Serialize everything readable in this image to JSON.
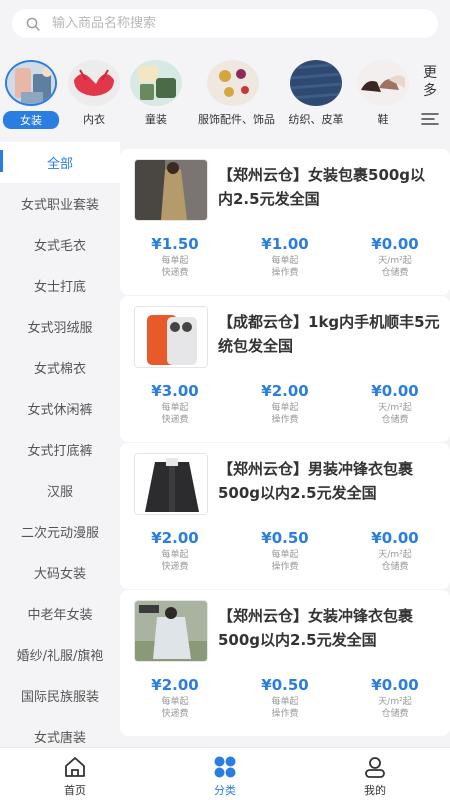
{
  "search": {
    "placeholder": "输入商品名称搜索"
  },
  "categories": [
    {
      "label": "女装",
      "active": true
    },
    {
      "label": "内衣"
    },
    {
      "label": "童装"
    },
    {
      "label": "服饰配件、饰品"
    },
    {
      "label": "纺织、皮革"
    },
    {
      "label": "鞋"
    }
  ],
  "more_label": "更多",
  "sidebar": {
    "items": [
      "全部",
      "女式职业套装",
      "女式毛衣",
      "女士打底",
      "女式羽绒服",
      "女式棉衣",
      "女式休闲裤",
      "女式打底裤",
      "汉服",
      "二次元动漫服",
      "大码女装",
      "中老年女装",
      "婚纱/礼服/旗袍",
      "国际民族服装",
      "女式唐装"
    ]
  },
  "fee_labels": {
    "express_unit": "每单起",
    "express_label": "快递费",
    "operation_unit": "每单起",
    "operation_label": "操作费",
    "storage_unit": "天/m²起",
    "storage_label": "仓储费"
  },
  "products": [
    {
      "title": "【郑州云仓】女装包裹500g以内2.5元发全国",
      "express": "¥1.50",
      "operation": "¥1.00",
      "storage": "¥0.00"
    },
    {
      "title": "【成都云仓】1kg内手机顺丰5元统包发全国",
      "express": "¥3.00",
      "operation": "¥2.00",
      "storage": "¥0.00"
    },
    {
      "title": "【郑州云仓】男装冲锋衣包裹500g以内2.5元发全国",
      "express": "¥2.00",
      "operation": "¥0.50",
      "storage": "¥0.00"
    },
    {
      "title": "【郑州云仓】女装冲锋衣包裹500g以内2.5元发全国",
      "express": "¥2.00",
      "operation": "¥0.50",
      "storage": "¥0.00"
    }
  ],
  "tabbar": {
    "home": "首页",
    "category": "分类",
    "mine": "我的"
  },
  "colors": {
    "accent": "#2a7de1",
    "background": "#f4f4f6"
  }
}
